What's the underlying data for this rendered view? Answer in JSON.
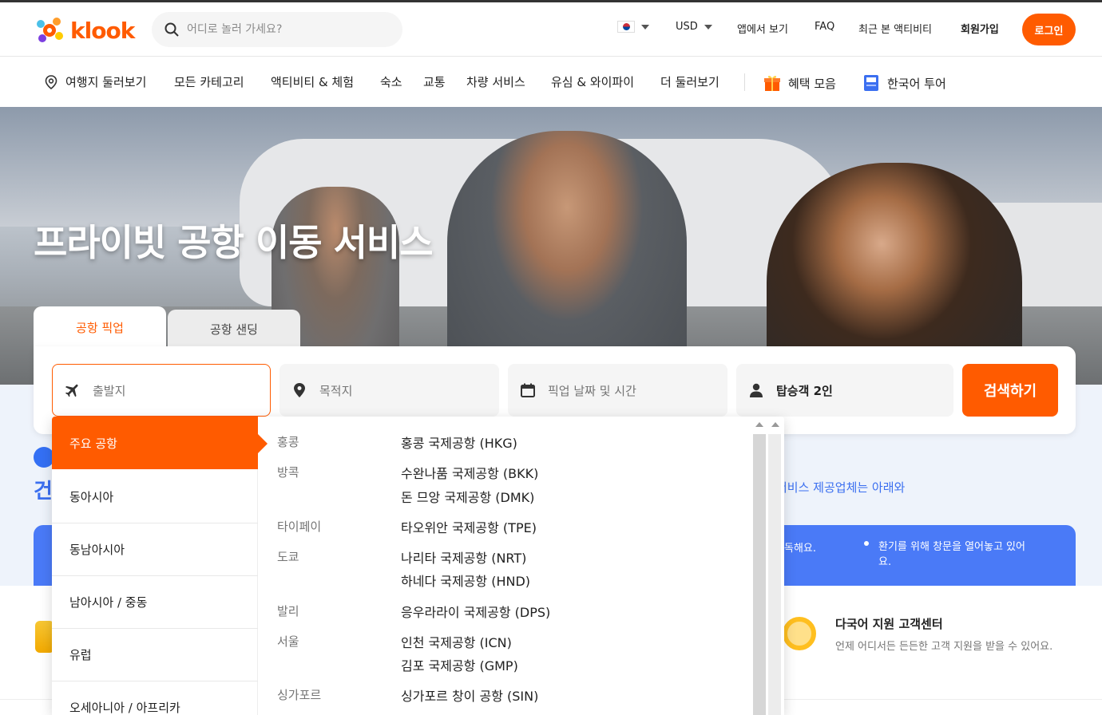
{
  "header": {
    "logo_text": "klook",
    "search_placeholder": "어디로 놀러 가세요?",
    "currency": "USD",
    "app_link": "앱에서 보기",
    "faq": "FAQ",
    "recent": "최근 본 액티비티",
    "signup": "회원가입",
    "login": "로그인"
  },
  "nav": {
    "items": [
      "여행지 둘러보기",
      "모든 카테고리",
      "액티비티 & 체험",
      "숙소",
      "교통",
      "차량 서비스",
      "유심 & 와이파이",
      "더 둘러보기"
    ],
    "deals": "혜택 모음",
    "korean_tour": "한국어 투어"
  },
  "hero": {
    "title": "프라이빗 공항 이동 서비스"
  },
  "tabs": {
    "pickup": "공항 픽업",
    "sending": "공항 샌딩"
  },
  "search_form": {
    "origin_placeholder": "출발지",
    "destination_placeholder": "목적지",
    "datetime_placeholder": "픽업 날짜 및 시간",
    "passengers": "탑승객 2인",
    "search_button": "검색하기"
  },
  "dropdown": {
    "regions": [
      "주요 공항",
      "동아시아",
      "동남아시아",
      "남아시아 / 중동",
      "유럽",
      "오세아니아 / 아프리카"
    ],
    "selected_region": "주요 공항",
    "groups": [
      {
        "city": "홍콩",
        "airports": [
          "홍콩 국제공항 (HKG)"
        ]
      },
      {
        "city": "방콕",
        "airports": [
          "수완나품 국제공항 (BKK)",
          "돈 므앙 국제공항 (DMK)"
        ]
      },
      {
        "city": "타이페이",
        "airports": [
          "타오위안 국제공항 (TPE)"
        ]
      },
      {
        "city": "도쿄",
        "airports": [
          "나리타 국제공항 (NRT)",
          "하네다 국제공항 (HND)"
        ]
      },
      {
        "city": "발리",
        "airports": [
          "응우라라이 국제공항 (DPS)"
        ]
      },
      {
        "city": "서울",
        "airports": [
          "인천 국제공항 (ICN)",
          "김포 국제공항 (GMP)"
        ]
      },
      {
        "city": "싱가포르",
        "airports": [
          "싱가포르 창이 공항 (SIN)"
        ]
      }
    ]
  },
  "background": {
    "heading_partial": "건",
    "sub_partial": "서비스 제공업체는 아래와",
    "notice_partial": "독해요.",
    "notice_bullet": "환기를 위해 창문을 열어놓고 있어요.",
    "support_title": "다국어 지원 고객센터",
    "support_desc": "언제 어디서든 든든한 고객 지원을 받을 수 있어요."
  },
  "colors": {
    "brand": "#ff5b00",
    "link_blue": "#3b6ff0"
  }
}
